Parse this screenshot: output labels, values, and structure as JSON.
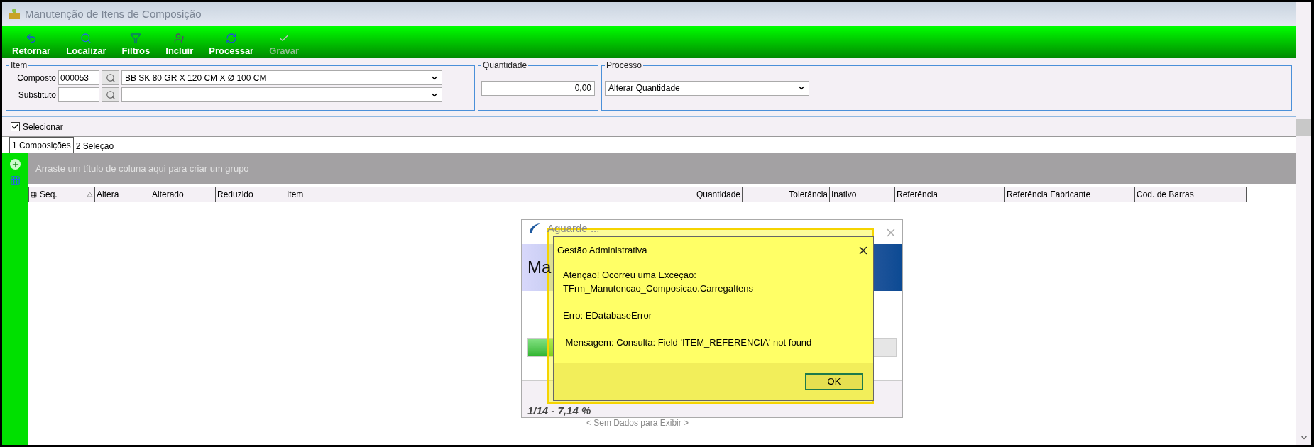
{
  "window": {
    "title": "Manutenção de Itens de Composição"
  },
  "toolbar": [
    {
      "label": "Retornar",
      "disabled": false
    },
    {
      "label": "Localizar",
      "disabled": false
    },
    {
      "label": "Filtros",
      "disabled": false
    },
    {
      "label": "Incluir",
      "disabled": false
    },
    {
      "label": "Processar",
      "disabled": false
    },
    {
      "label": "Gravar",
      "disabled": true
    }
  ],
  "item_group": {
    "title": "Item",
    "rows": [
      {
        "label": "Composto",
        "code": "000053",
        "description": "BB SK 80 GR X 120 CM X Ø 100 CM"
      },
      {
        "label": "Substituto"
      }
    ]
  },
  "quantity_group": {
    "title": "Quantidade",
    "value": "0,00"
  },
  "process_group": {
    "title": "Processo",
    "value": "Alterar Quantidade"
  },
  "select_checkbox": {
    "label": "Selecionar",
    "checked": true
  },
  "tabs": [
    {
      "label": "1 Composições",
      "selected": true
    },
    {
      "label": "2 Seleção",
      "selected": false
    }
  ],
  "grid": {
    "group_hint": "Arraste um título de coluna aqui para criar um grupo",
    "columns": [
      {
        "label": "Seq.",
        "kind": "text",
        "sorted": true
      },
      {
        "label": "Altera",
        "kind": "text",
        "sorted": false
      },
      {
        "label": "Alterado",
        "kind": "text",
        "sorted": false
      },
      {
        "label": "Reduzido",
        "kind": "text",
        "sorted": false
      },
      {
        "label": "Item",
        "kind": "text",
        "sorted": false
      },
      {
        "label": "Quantidade",
        "kind": "number",
        "sorted": false
      },
      {
        "label": "Tolerância",
        "kind": "number",
        "sorted": false
      },
      {
        "label": "Inativo",
        "kind": "text",
        "sorted": false
      },
      {
        "label": "Referência",
        "kind": "text",
        "sorted": false
      },
      {
        "label": "Referência Fabricante",
        "kind": "text",
        "sorted": false
      },
      {
        "label": "Cod. de Barras",
        "kind": "text",
        "sorted": false
      }
    ],
    "empty_text": "< Sem Dados para Exibir >"
  },
  "progress_dialog": {
    "title": "Aguarde ...",
    "heading": "Ma",
    "level": 0.0714,
    "status": "1/14 - 7,14 %"
  },
  "error_dialog": {
    "title": "Gestão Administrativa",
    "paragraphs": [
      [
        "Atenção! Ocorreu uma Exceção:",
        "TFrm_Manutencao_Composicao.CarregaItens"
      ],
      [
        "Erro: EDatabaseError"
      ],
      [
        " Mensagem: Consulta: Field 'ITEM_REFERENCIA' not found"
      ]
    ],
    "button": "OK"
  }
}
